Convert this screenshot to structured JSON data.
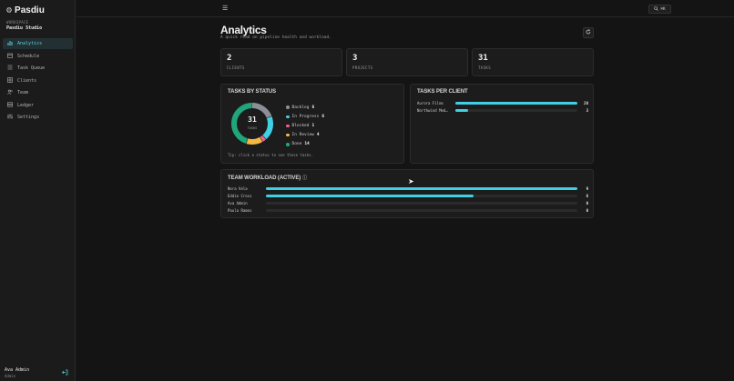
{
  "app": {
    "name": "Pasdiu"
  },
  "workspace": {
    "label": "WORKSPACE",
    "name": "Pasdiu Studio"
  },
  "nav": [
    {
      "label": "Analytics",
      "icon": "bar-chart-icon",
      "active": true
    },
    {
      "label": "Schedule",
      "icon": "calendar-icon",
      "active": false
    },
    {
      "label": "Task Queue",
      "icon": "list-icon",
      "active": false
    },
    {
      "label": "Clients",
      "icon": "grid-icon",
      "active": false
    },
    {
      "label": "Team",
      "icon": "users-icon",
      "active": false
    },
    {
      "label": "Ledger",
      "icon": "ledger-icon",
      "active": false
    },
    {
      "label": "Settings",
      "icon": "sliders-icon",
      "active": false
    }
  ],
  "user": {
    "name": "Ava Admin",
    "role": "Admin"
  },
  "topbar": {
    "search_shortcut": "⌘K"
  },
  "page": {
    "title": "Analytics",
    "subtitle": "A quick read on pipeline health and workload."
  },
  "stats": [
    {
      "value": "2",
      "label": "CLIENTS"
    },
    {
      "value": "3",
      "label": "PROJECTS"
    },
    {
      "value": "31",
      "label": "TASKS"
    }
  ],
  "tasks_by_status": {
    "title": "TASKS BY STATUS",
    "total": "31",
    "total_label": "TASKS",
    "tip": "Tip: click a status to see those tasks.",
    "statuses": [
      {
        "name": "Backlog",
        "count": 6,
        "color": "#8a8f98"
      },
      {
        "name": "In Progress",
        "count": 6,
        "color": "#3fd0e6"
      },
      {
        "name": "Blocked",
        "count": 1,
        "color": "#f06292"
      },
      {
        "name": "In Review",
        "count": 4,
        "color": "#f5b942"
      },
      {
        "name": "Done",
        "count": 14,
        "color": "#1fa67a"
      }
    ]
  },
  "tasks_per_client": {
    "title": "TASKS PER CLIENT",
    "max": 28,
    "rows": [
      {
        "name": "Aurora Films",
        "value": 28
      },
      {
        "name": "Northwind Med…",
        "value": 3
      }
    ]
  },
  "team_workload": {
    "title": "TEAM WORKLOAD (ACTIVE)",
    "max": 9,
    "rows": [
      {
        "name": "Nora Vela",
        "value": 9
      },
      {
        "name": "Eddie Cross",
        "value": 6
      },
      {
        "name": "Ava Admin",
        "value": 0
      },
      {
        "name": "Paula Ramos",
        "value": 0
      }
    ]
  },
  "colors": {
    "accent": "#3fd0e6",
    "background": "#141414",
    "card": "#1c1c1c"
  }
}
